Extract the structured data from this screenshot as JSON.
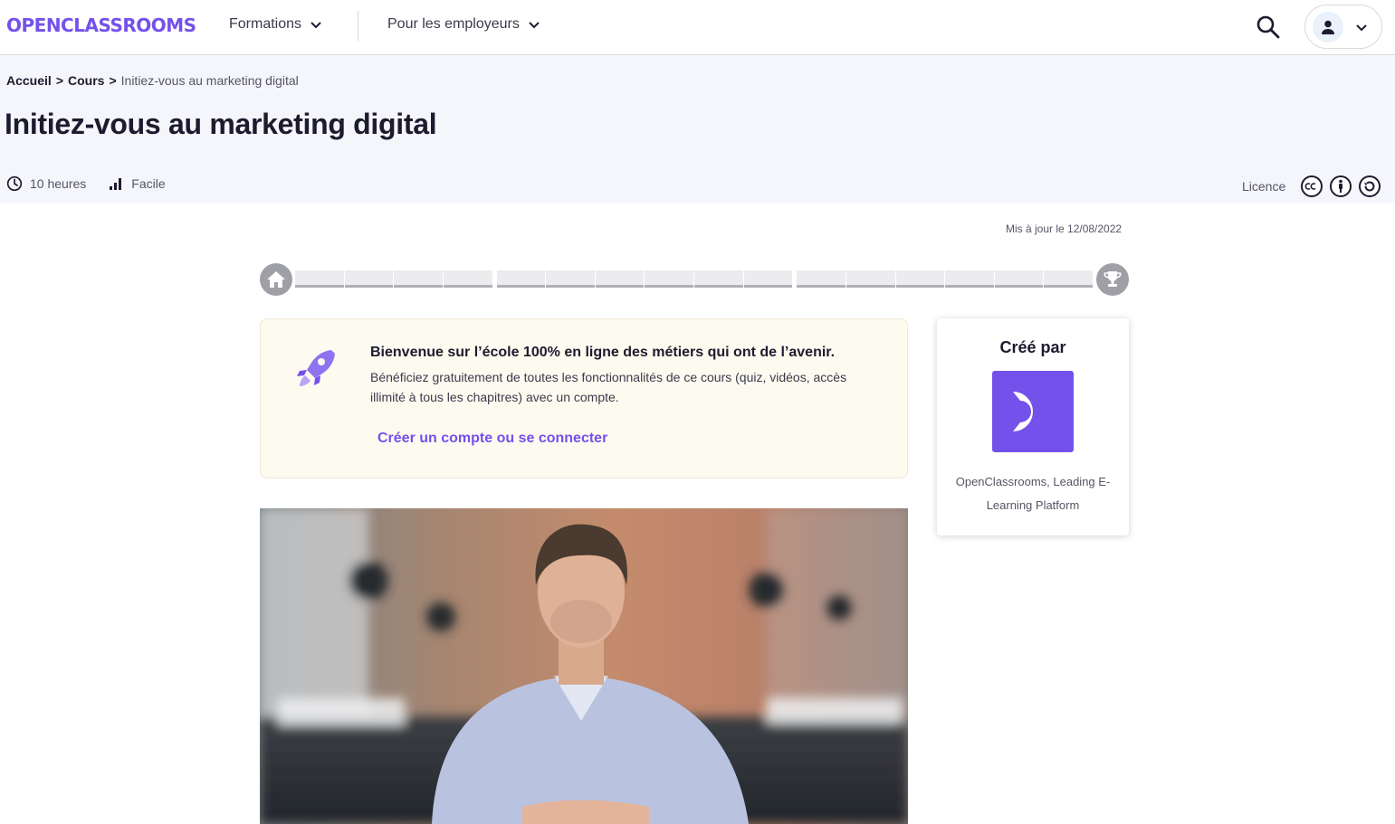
{
  "nav": {
    "logo": "OPENCLASSROOMS",
    "formations": "Formations",
    "employeurs": "Pour les employeurs"
  },
  "breadcrumb": {
    "home": "Accueil",
    "courses": "Cours",
    "current": "Initiez-vous au marketing digital",
    "separator": ">"
  },
  "course": {
    "title": "Initiez-vous au marketing digital",
    "duration": "10 heures",
    "level": "Facile",
    "licence": "Licence",
    "updated": "Mis à jour le 12/08/2022"
  },
  "progress": {
    "groups": [
      4,
      6,
      6
    ],
    "completed": 0
  },
  "welcome": {
    "title": "Bienvenue sur l’école 100% en ligne des métiers qui ont de l’avenir.",
    "body": "Bénéficiez gratuitement de toutes les fonctionnalités de ce cours (quiz, vidéos, accès illimité à tous les chapitres) avec un compte.",
    "cta": "Créer un compte ou se connecter"
  },
  "author": {
    "heading": "Créé par",
    "name": "OpenClassrooms, Leading E-Learning Platform"
  },
  "colors": {
    "brand": "#7451eb",
    "band": "#f5f5fc",
    "welcome_bg": "#fdfaf0",
    "progress_circle": "#9f9fa6"
  },
  "icons": {
    "search": "search-icon",
    "account": "user-icon",
    "clock": "clock-icon",
    "level": "bar-chart-icon",
    "home": "home-icon",
    "trophy": "trophy-icon",
    "rocket": "rocket-icon"
  }
}
